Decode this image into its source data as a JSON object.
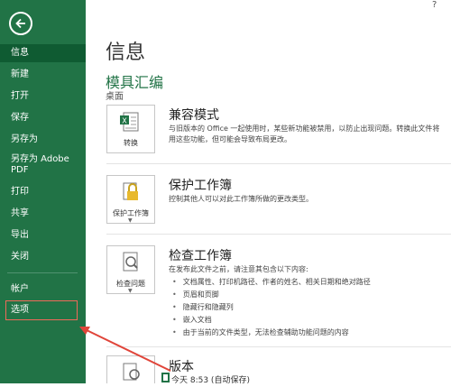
{
  "topbar": {
    "glyph": "?"
  },
  "sidebar": {
    "items": [
      {
        "label": "信息"
      },
      {
        "label": "新建"
      },
      {
        "label": "打开"
      },
      {
        "label": "保存"
      },
      {
        "label": "另存为"
      },
      {
        "label": "另存为 Adobe"
      },
      {
        "label": "PDF"
      },
      {
        "label": "打印"
      },
      {
        "label": "共享"
      },
      {
        "label": "导出"
      },
      {
        "label": "关闭"
      },
      {
        "label": "帐户"
      },
      {
        "label": "选项"
      }
    ]
  },
  "main": {
    "title": "信息",
    "doc_name": "模具汇编",
    "location": "桌面",
    "compat": {
      "button_label": "转换",
      "title": "兼容模式",
      "desc1": "与旧版本的 Office 一起使用时，某些新功能被禁用，以防止出现问题。转换此文件将",
      "desc2": "用这些功能，但可能会导致布局更改。"
    },
    "protect": {
      "button_label": "保护工作簿",
      "title": "保护工作簿",
      "desc": "控制其他人可以对此工作簿所做的更改类型。"
    },
    "inspect": {
      "button_label": "检查问题",
      "title": "检查工作簿",
      "desc": "在发布此文件之前，请注意其包含以下内容:",
      "bullets": [
        "文档属性、打印机路径、作者的姓名、相关日期和绝对路径",
        "页眉和页脚",
        "隐藏行和隐藏列",
        "嵌入文档",
        "由于当前的文件类型，无法检查辅助功能问题的内容"
      ]
    },
    "versions": {
      "title": "版本",
      "entry": "今天 8:53 (自动保存)"
    }
  },
  "colors": {
    "sidebar": "#217346",
    "accent": "#217346",
    "annotation": "#e0453a"
  }
}
